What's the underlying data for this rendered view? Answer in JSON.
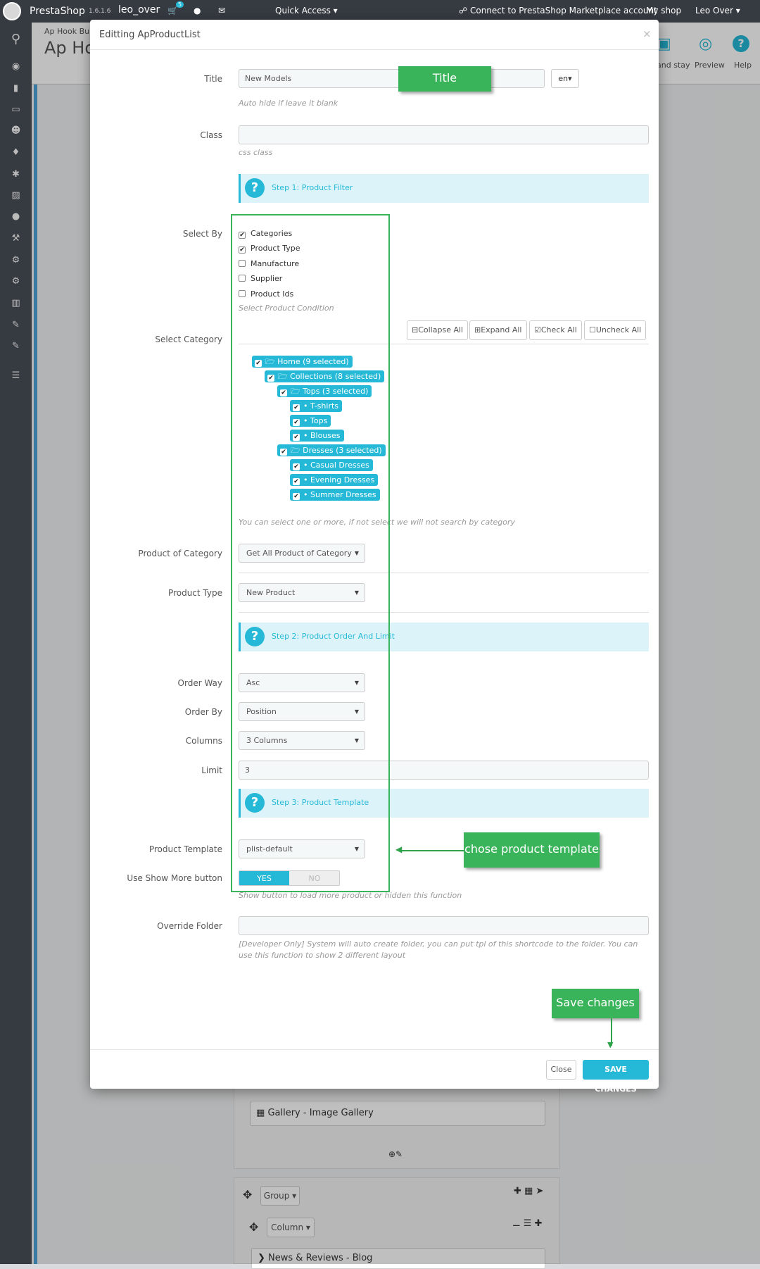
{
  "topbar": {
    "brand": "PrestaShop",
    "version": "1.6.1.6",
    "user_short": "leo_over",
    "cart_badge": "5",
    "quick_access": "Quick Access",
    "connect": "Connect to PrestaShop Marketplace account",
    "my_shop": "My shop",
    "account": "Leo Over"
  },
  "background": {
    "breadcrumb": "Ap Hook Buil",
    "page_title": "Ap Ho",
    "toolbar": {
      "save_stay": "and stay",
      "preview": "Preview",
      "help": "Help"
    },
    "gallery_item": "Gallery - Image Gallery",
    "group_label": "Group",
    "column_label": "Column",
    "news_item": "News & Reviews - Blog"
  },
  "modal": {
    "title": "Editting ApProductList",
    "close_symbol": "×",
    "fields": {
      "title_label": "Title",
      "title_value": "New Models",
      "lang": "en",
      "title_hint": "Auto hide if leave it blank",
      "class_label": "Class",
      "class_hint": "css class",
      "step1": "Step 1: Product Filter",
      "select_by_label": "Select By",
      "select_by_options": [
        {
          "label": "Categories",
          "checked": true
        },
        {
          "label": "Product Type",
          "checked": true
        },
        {
          "label": "Manufacture",
          "checked": false
        },
        {
          "label": "Supplier",
          "checked": false
        },
        {
          "label": "Product Ids",
          "checked": false
        }
      ],
      "select_by_hint": "Select Product Condition",
      "select_category_label": "Select Category",
      "tree_buttons": {
        "collapse": "Collapse All",
        "expand": "Expand All",
        "check": "Check All",
        "uncheck": "Uncheck All"
      },
      "tree": [
        {
          "label": "Home (9 selected)",
          "level": 0,
          "folder": true
        },
        {
          "label": "Collections (8 selected)",
          "level": 1,
          "folder": true
        },
        {
          "label": "Tops (3 selected)",
          "level": 2,
          "folder": true
        },
        {
          "label": "T-shirts",
          "level": 3,
          "folder": false
        },
        {
          "label": "Tops",
          "level": 3,
          "folder": false
        },
        {
          "label": "Blouses",
          "level": 3,
          "folder": false
        },
        {
          "label": "Dresses (3 selected)",
          "level": 2,
          "folder": true
        },
        {
          "label": "Casual Dresses",
          "level": 3,
          "folder": false
        },
        {
          "label": "Evening Dresses",
          "level": 3,
          "folder": false
        },
        {
          "label": "Summer Dresses",
          "level": 3,
          "folder": false
        }
      ],
      "category_hint": "You can select one or more, if not select we will not search by category",
      "product_of_category_label": "Product of Category",
      "product_of_category_value": "Get All Product of Category",
      "product_type_label": "Product Type",
      "product_type_value": "New Product",
      "step2": "Step 2: Product Order And Limit",
      "order_way_label": "Order Way",
      "order_way_value": "Asc",
      "order_by_label": "Order By",
      "order_by_value": "Position",
      "columns_label": "Columns",
      "columns_value": "3 Columns",
      "limit_label": "Limit",
      "limit_value": "3",
      "step3": "Step 3: Product Template",
      "product_template_label": "Product Template",
      "product_template_value": "plist-default",
      "show_more_label": "Use Show More button",
      "toggle_yes": "YES",
      "toggle_no": "NO",
      "show_more_hint": "Show button to load more product or hidden this function",
      "override_folder_label": "Override Folder",
      "override_hint": "[Developer Only] System will auto create folder, you can put tpl of this shortcode to the folder. You can use this function to show 2 different layout"
    },
    "footer": {
      "close": "Close",
      "save": "SAVE CHANGES"
    }
  },
  "annotations": {
    "title_callout": "Title",
    "template_callout": "chose product template",
    "save_callout": "Save changes"
  },
  "colors": {
    "accent": "#25b9d7",
    "callout": "#3ab45a",
    "dark": "#363a41"
  }
}
